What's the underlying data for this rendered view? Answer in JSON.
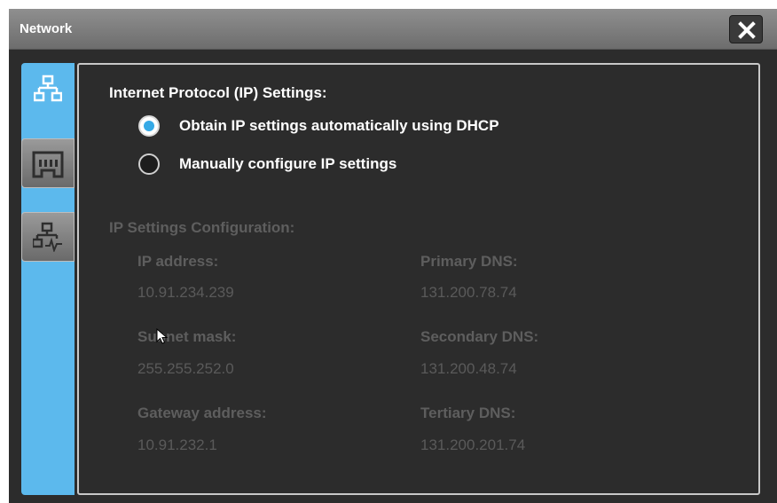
{
  "window": {
    "title": "Network"
  },
  "tabs": [
    {
      "name": "network-settings",
      "icon": "network-icon",
      "active": true
    },
    {
      "name": "ethernet",
      "icon": "ethernet-port-icon",
      "active": false
    },
    {
      "name": "network-diagnostics",
      "icon": "network-activity-icon",
      "active": false
    }
  ],
  "ip_settings": {
    "title": "Internet Protocol (IP) Settings:",
    "options": [
      {
        "label": "Obtain IP settings automatically using DHCP",
        "selected": true
      },
      {
        "label": "Manually configure IP settings",
        "selected": false
      }
    ]
  },
  "config": {
    "title": "IP Settings Configuration:",
    "ip_address": {
      "label": "IP address:",
      "value": "10.91.234.239"
    },
    "subnet_mask": {
      "label": "Subnet mask:",
      "value": "255.255.252.0"
    },
    "gateway": {
      "label": "Gateway address:",
      "value": "10.91.232.1"
    },
    "primary_dns": {
      "label": "Primary DNS:",
      "value": "131.200.78.74"
    },
    "secondary_dns": {
      "label": "Secondary DNS:",
      "value": "131.200.48.74"
    },
    "tertiary_dns": {
      "label": "Tertiary DNS:",
      "value": "131.200.201.74"
    }
  },
  "colors": {
    "accent": "#5cb9ed",
    "background": "#2c2c2c",
    "disabled_text": "#5e5e5e"
  }
}
